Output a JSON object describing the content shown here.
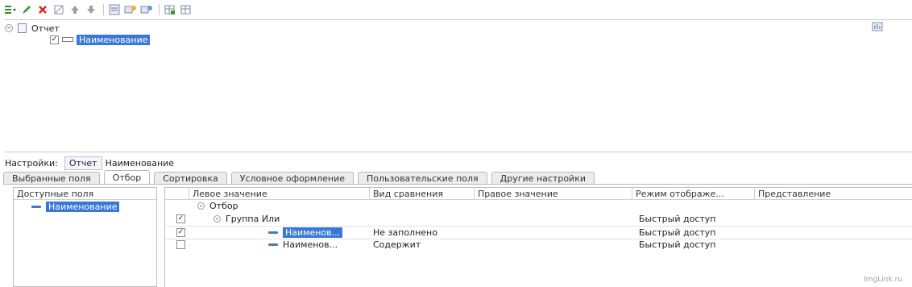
{
  "toolbar": {
    "icons": [
      "add-dropdown-icon",
      "edit-icon",
      "delete-icon",
      "clear-icon",
      "move-up-icon",
      "move-down-icon",
      "group-icon",
      "field-icon-1",
      "field-icon-2",
      "table-icon-1",
      "table-icon-2"
    ]
  },
  "tree": {
    "root_label": "Отчет",
    "child_label": "Наименование"
  },
  "settings": {
    "label": "Настройки:",
    "segment_label": "Отчет",
    "segment_value": "Наименование"
  },
  "tabs": [
    {
      "label": "Выбранные поля"
    },
    {
      "label": "Отбор"
    },
    {
      "label": "Сортировка"
    },
    {
      "label": "Условное оформление"
    },
    {
      "label": "Пользовательские поля"
    },
    {
      "label": "Другие настройки"
    }
  ],
  "left_panel": {
    "header": "Доступные поля",
    "item": "Наименование"
  },
  "grid": {
    "columns": [
      "Левое значение",
      "Вид сравнения",
      "Правое значение",
      "Режим отображе...",
      "Представление"
    ],
    "rows": [
      {
        "checked": null,
        "left": "Отбор",
        "cmp": "",
        "right": "",
        "mode": "",
        "repr": ""
      },
      {
        "checked": true,
        "left": "Группа Или",
        "cmp": "",
        "right": "",
        "mode": "Быстрый доступ",
        "repr": ""
      },
      {
        "checked": true,
        "left": "Наименов...",
        "cmp": "Не заполнено",
        "right": "",
        "mode": "Быстрый доступ",
        "repr": ""
      },
      {
        "checked": false,
        "left": "Наименов...",
        "cmp": "Содержит",
        "right": "",
        "mode": "Быстрый доступ",
        "repr": ""
      }
    ]
  },
  "watermark": "ImgLink.ru"
}
